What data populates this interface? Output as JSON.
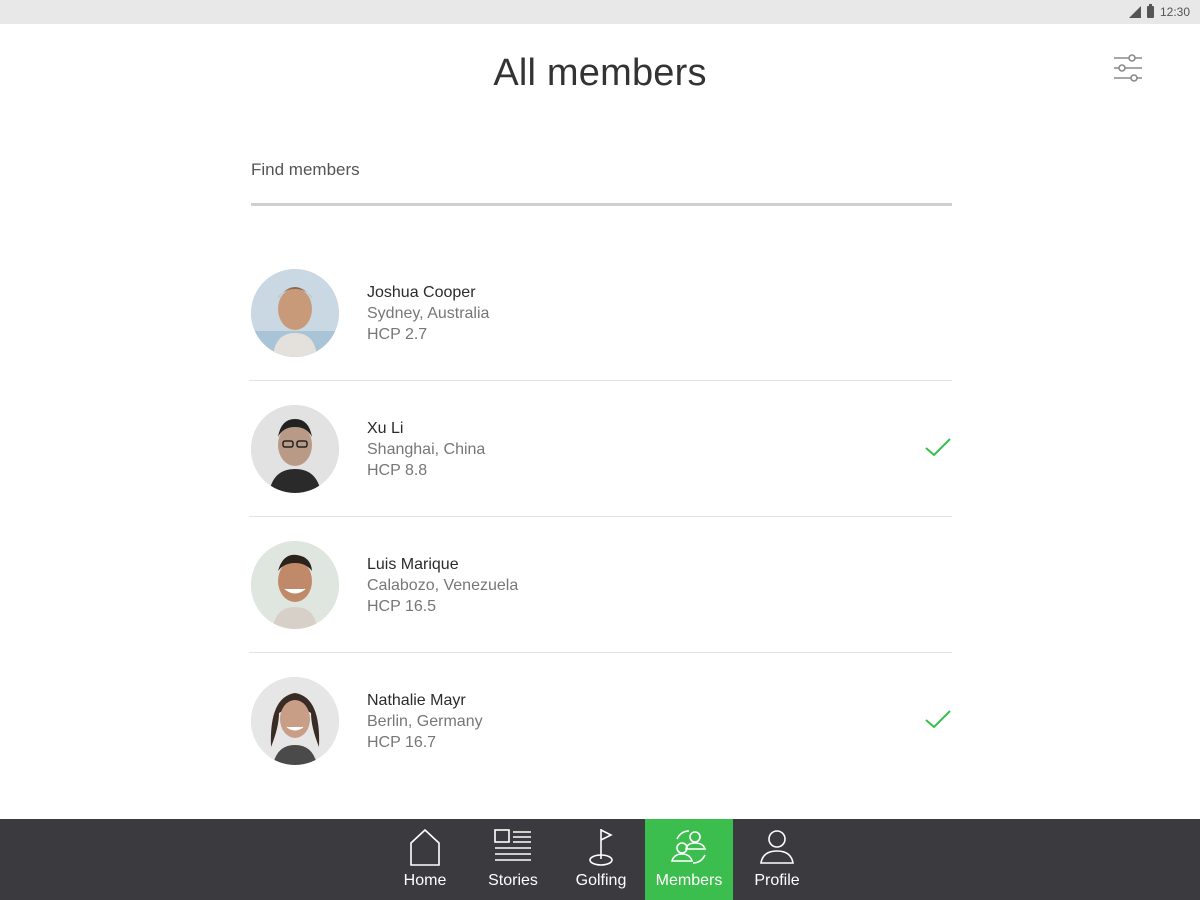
{
  "status_bar": {
    "time": "12:30"
  },
  "header": {
    "title": "All members"
  },
  "search": {
    "placeholder": "Find members",
    "value": ""
  },
  "members": [
    {
      "name": "Joshua Cooper",
      "location": "Sydney, Australia",
      "hcp": "HCP 2.7",
      "checked": false
    },
    {
      "name": "Xu Li",
      "location": "Shanghai, China",
      "hcp": "HCP 8.8",
      "checked": true
    },
    {
      "name": "Luis Marique",
      "location": "Calabozo, Venezuela",
      "hcp": "HCP 16.5",
      "checked": false
    },
    {
      "name": "Nathalie Mayr",
      "location": "Berlin, Germany",
      "hcp": "HCP 16.7",
      "checked": true
    }
  ],
  "nav": {
    "items": [
      {
        "label": "Home",
        "icon": "home-icon"
      },
      {
        "label": "Stories",
        "icon": "stories-icon"
      },
      {
        "label": "Golfing",
        "icon": "golf-flag-icon"
      },
      {
        "label": "Members",
        "icon": "members-icon"
      },
      {
        "label": "Profile",
        "icon": "profile-icon"
      }
    ],
    "active": "Members"
  },
  "colors": {
    "accent": "#3cbe4e",
    "nav_bg": "#3b3b3f",
    "check": "#3cbe4e"
  }
}
